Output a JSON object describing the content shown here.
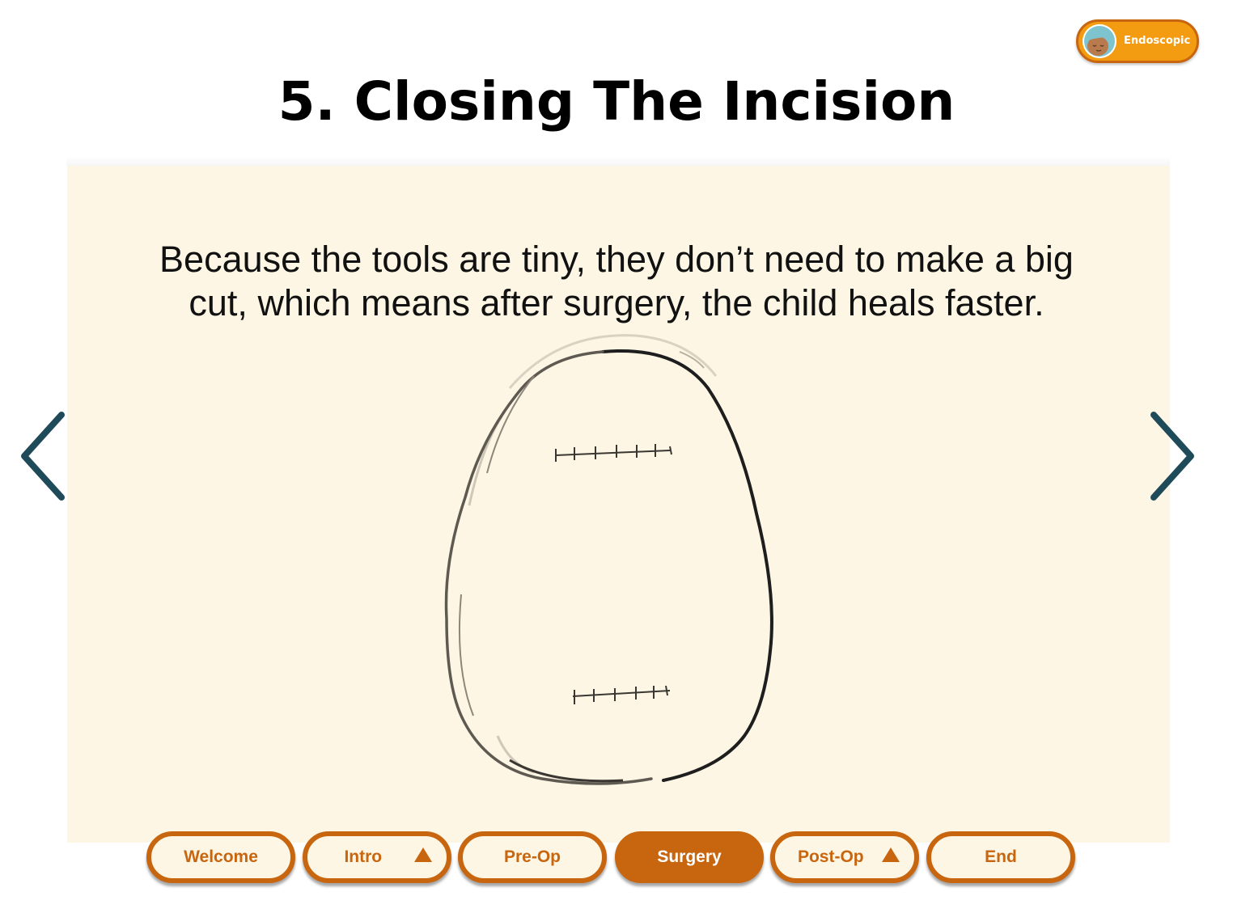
{
  "badge": {
    "label": "Endoscopic",
    "avatar_icon": "child-avatar-icon",
    "color": "#f39c12"
  },
  "page": {
    "title": "5. Closing The Incision",
    "caption": "Because the tools are tiny, they don’t need to make a big cut, which means after surgery, the child heals faster."
  },
  "illustration": {
    "icon": "head-with-stitches-illustration"
  },
  "arrows": {
    "prev_icon": "chevron-left-icon",
    "next_icon": "chevron-right-icon",
    "color": "#1f4a5a"
  },
  "nav": {
    "items": [
      {
        "label": "Welcome",
        "has_dropdown": false,
        "active": false
      },
      {
        "label": "Intro",
        "has_dropdown": true,
        "active": false
      },
      {
        "label": "Pre-Op",
        "has_dropdown": false,
        "active": false
      },
      {
        "label": "Surgery",
        "has_dropdown": false,
        "active": true
      },
      {
        "label": "Post-Op",
        "has_dropdown": true,
        "active": false
      },
      {
        "label": "End",
        "has_dropdown": false,
        "active": false
      }
    ],
    "accent_color": "#c8650f",
    "background_color": "#fdf6e4"
  }
}
